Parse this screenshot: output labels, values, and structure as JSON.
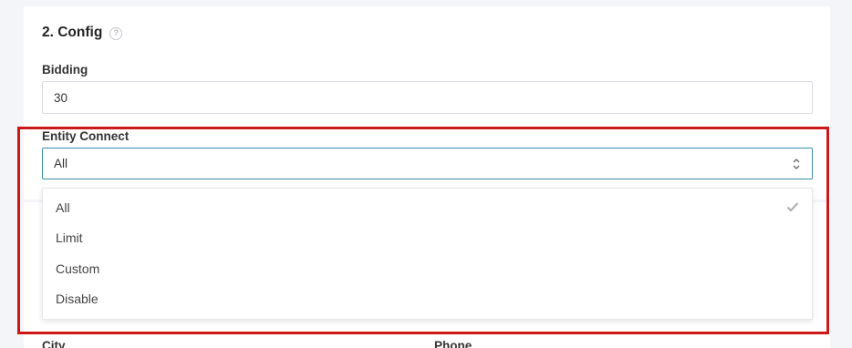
{
  "config": {
    "title": "2. Config",
    "help_icon": "question-circle-icon"
  },
  "bidding": {
    "label": "Bidding",
    "value": "30"
  },
  "entity_connect": {
    "label": "Entity Connect",
    "selected": "All",
    "options": [
      {
        "label": "All",
        "selected": true
      },
      {
        "label": "Limit",
        "selected": false
      },
      {
        "label": "Custom",
        "selected": false
      },
      {
        "label": "Disable",
        "selected": false
      }
    ],
    "check_icon": "check-icon",
    "arrows_icon": "sort-arrows-icon"
  },
  "next_section": {
    "city_label": "City",
    "phone_label": "Phone"
  },
  "colors": {
    "highlight": "#cc1818",
    "focus_border": "#3a8eae",
    "background": "#f3f5f9"
  }
}
